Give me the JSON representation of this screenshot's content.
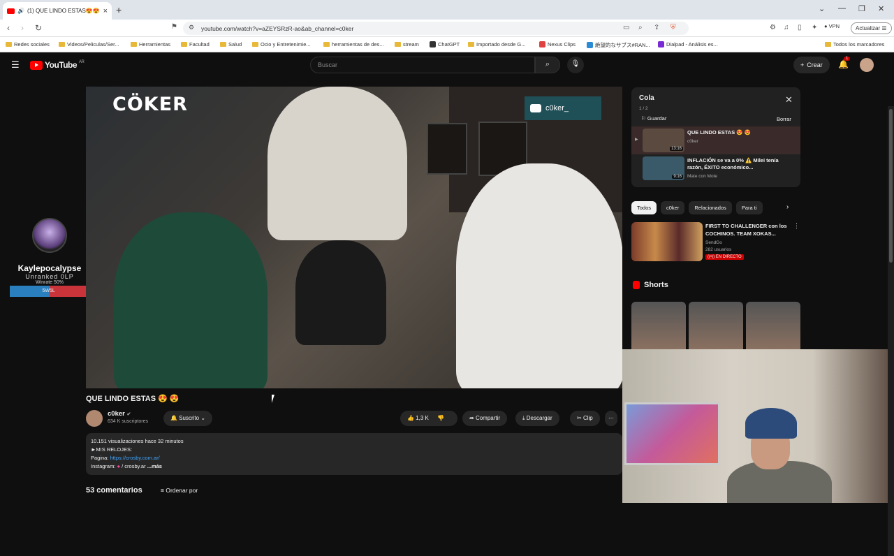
{
  "browser": {
    "tab_title": "(1) QUE LINDO ESTAS😍😍",
    "new_tab": "+",
    "url": "youtube.com/watch?v=aZEYSRzR-ao&ab_channel=c0ker",
    "vpn": "VPN",
    "update_label": "Actualizar",
    "bookmarks": [
      "Redes sociales",
      "Videos/Peliculas/Ser...",
      "Herramientas",
      "Facultad",
      "Salud",
      "Ocio y Entretenimie...",
      "herramientas de des...",
      "stream",
      "ChatGPT",
      "Importado desde G...",
      "Nexus Clips",
      "絶望的なサブス#RAN...",
      "Dialpad - Análisis es...",
      "Todos los marcadores"
    ]
  },
  "youtube": {
    "logo_text": "YouTube",
    "country": "AR",
    "search_placeholder": "Buscar",
    "create_label": "Crear",
    "notif_count": "1"
  },
  "overlay": {
    "name": "Kaylepocalypse",
    "rank": "Unranked 0LP",
    "winrate_text": "Winrate 50%",
    "wins": "5W",
    "losses": "5L",
    "winrate": 0.5
  },
  "video": {
    "watermark": "CÖKER",
    "channel_tag": "c0ker_",
    "title": "QUE LINDO ESTAS 😍 😍",
    "channel": "c0ker",
    "verified": "✔",
    "subs": "634 K suscriptores",
    "subscribe_label": "Suscrito",
    "likes": "1,3 K",
    "share_label": "Compartir",
    "download_label": "Descargar",
    "clip_label": "Clip",
    "desc_line1": "10.151 visualizaciones  hace 32 minutos",
    "desc_line2": "►MIS RELOJES:",
    "desc_line3_label": "Pagina: ",
    "desc_line3_link": "https://crosby.com.ar/",
    "desc_line4": "Instagram: ",
    "desc_line4_handle": "/ crosby.ar",
    "desc_more": "...más",
    "comments": "53 comentarios",
    "sort_label": "Ordenar por"
  },
  "queue": {
    "title": "Cola",
    "count": "1 / 2",
    "save_label": "Guardar",
    "delete_label": "Borrar",
    "items": [
      {
        "title": "QUE LINDO ESTAS 😍 😍",
        "channel": "c0ker",
        "duration": "13:16"
      },
      {
        "title": "INFLACIÓN se va a 0% ⚠️ Milei tenía razón, ÉXITO económico...",
        "channel": "Mate con Mote",
        "duration": "9:16"
      }
    ]
  },
  "chips": [
    "Todos",
    "c0ker",
    "Relacionados",
    "Para ti"
  ],
  "recommended": {
    "title": "FIRST TO CHALLENGER con los COCHINOS. TEAM XOKAS...",
    "channel": "SendGo",
    "viewers": "282 usuarios",
    "live_label": "((•)) EN DIRECTO"
  },
  "shorts_label": "Shorts",
  "colors": {
    "accent": "#ff0000",
    "link": "#3ea6ff",
    "bg": "#0f0f0f"
  }
}
